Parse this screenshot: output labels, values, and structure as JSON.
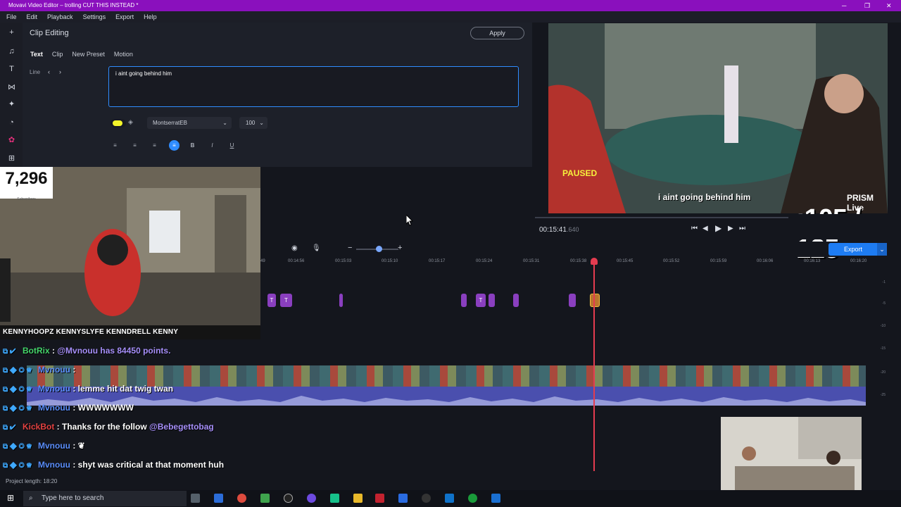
{
  "window": {
    "title": "Movavi Video Editor – trolling CUT THIS INSTEAD *"
  },
  "menu": [
    "File",
    "Edit",
    "Playback",
    "Settings",
    "Export",
    "Help"
  ],
  "editor": {
    "title": "Clip Editing",
    "apply_label": "Apply",
    "tabs": [
      "Text",
      "Clip",
      "New Preset",
      "Motion"
    ],
    "line_label": "Line",
    "text_value": "i aint going behind him",
    "font": "MontserratEB",
    "size": "100",
    "text_color": "#f4f52a"
  },
  "webcam": {
    "subscribers": "7,296",
    "subscribers_label": "Subscribers",
    "socials": "KENNYHOOPZ  KENNYSLYFE  KENNDRELL  KENNY"
  },
  "preview": {
    "paused": "PAUSED",
    "subtitle": "i aint going behind him",
    "prism": "PRISM Live",
    "counter": ":105 / 125",
    "time": "00:15:41",
    "time_frac": ".640"
  },
  "timeline": {
    "export_label": "Export",
    "ticks": [
      "49",
      "00:14:56",
      "00:15:03",
      "00:15:10",
      "00:15:17",
      "00:15:24",
      "00:15:31",
      "00:15:38",
      "00:15:45",
      "00:15:52",
      "00:15:59",
      "00:16:06",
      "00:16:13",
      "00:16:20"
    ],
    "scale": [
      "-1",
      "-5",
      "-10",
      "-15",
      "-20",
      "-25"
    ],
    "project_length": "Project length: 18:20"
  },
  "chat": [
    {
      "user": "BotRix",
      "sep": " : ",
      "message": "@Mvnouu has 84450 points.",
      "color": "green"
    },
    {
      "user": "Mvnouu",
      "sep": " : ",
      "message": "",
      "color": "blue"
    },
    {
      "user": "Mvnouu",
      "sep": " : ",
      "message": "lemme hit dat twig twan",
      "color": "blue"
    },
    {
      "user": "Mvnouu",
      "sep": " : ",
      "message": "WWWWWWW",
      "color": "blue"
    },
    {
      "user": "KickBot",
      "sep": " : ",
      "message": "Thanks for the follow ",
      "mention": "@Bebegettobag",
      "color": "red"
    },
    {
      "user": "Mvnouu",
      "sep": " : ",
      "message": "",
      "color": "blue"
    },
    {
      "user": "Mvnouu",
      "sep": " : ",
      "message": "shyt was critical at that moment huh",
      "color": "blue"
    }
  ],
  "taskbar": {
    "search_placeholder": "Type here to search"
  }
}
